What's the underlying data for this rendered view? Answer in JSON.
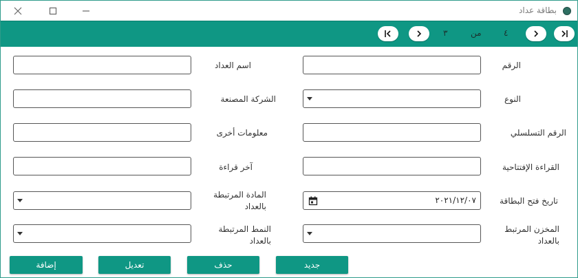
{
  "window": {
    "title": "بطاقة عداد"
  },
  "navigation": {
    "current_page": "٣",
    "of_label": "من",
    "total_pages": "٤"
  },
  "form": {
    "number_label": "الرقم",
    "meter_name_label": "اسم العداد",
    "type_label": "النوع",
    "manufacturer_label": "الشركة المصنعة",
    "serial_label": "الرقم التسلسلي",
    "other_info_label": "معلومات أخرى",
    "initial_reading_label": "القراءة الإفتتاحية",
    "last_reading_label": "آخر قراءة",
    "card_open_date_label": "تاريخ فتح البطاقة",
    "card_open_date_value": "٢٠٢١/١٢/٠٧",
    "linked_material_label_1": "المادة المرتبطة",
    "linked_material_label_2": "بالعداد",
    "linked_store_label_1": "المخزن المرتبط",
    "linked_store_label_2": "بالعداد",
    "linked_pattern_label_1": "النمط المرتبطة",
    "linked_pattern_label_2": "بالعداد"
  },
  "actions": {
    "new_label": "جديد",
    "delete_label": "حذف",
    "edit_label": "تعديل",
    "add_label": "إضافة"
  },
  "colors": {
    "accent": "#0f9784",
    "border": "#555555"
  }
}
